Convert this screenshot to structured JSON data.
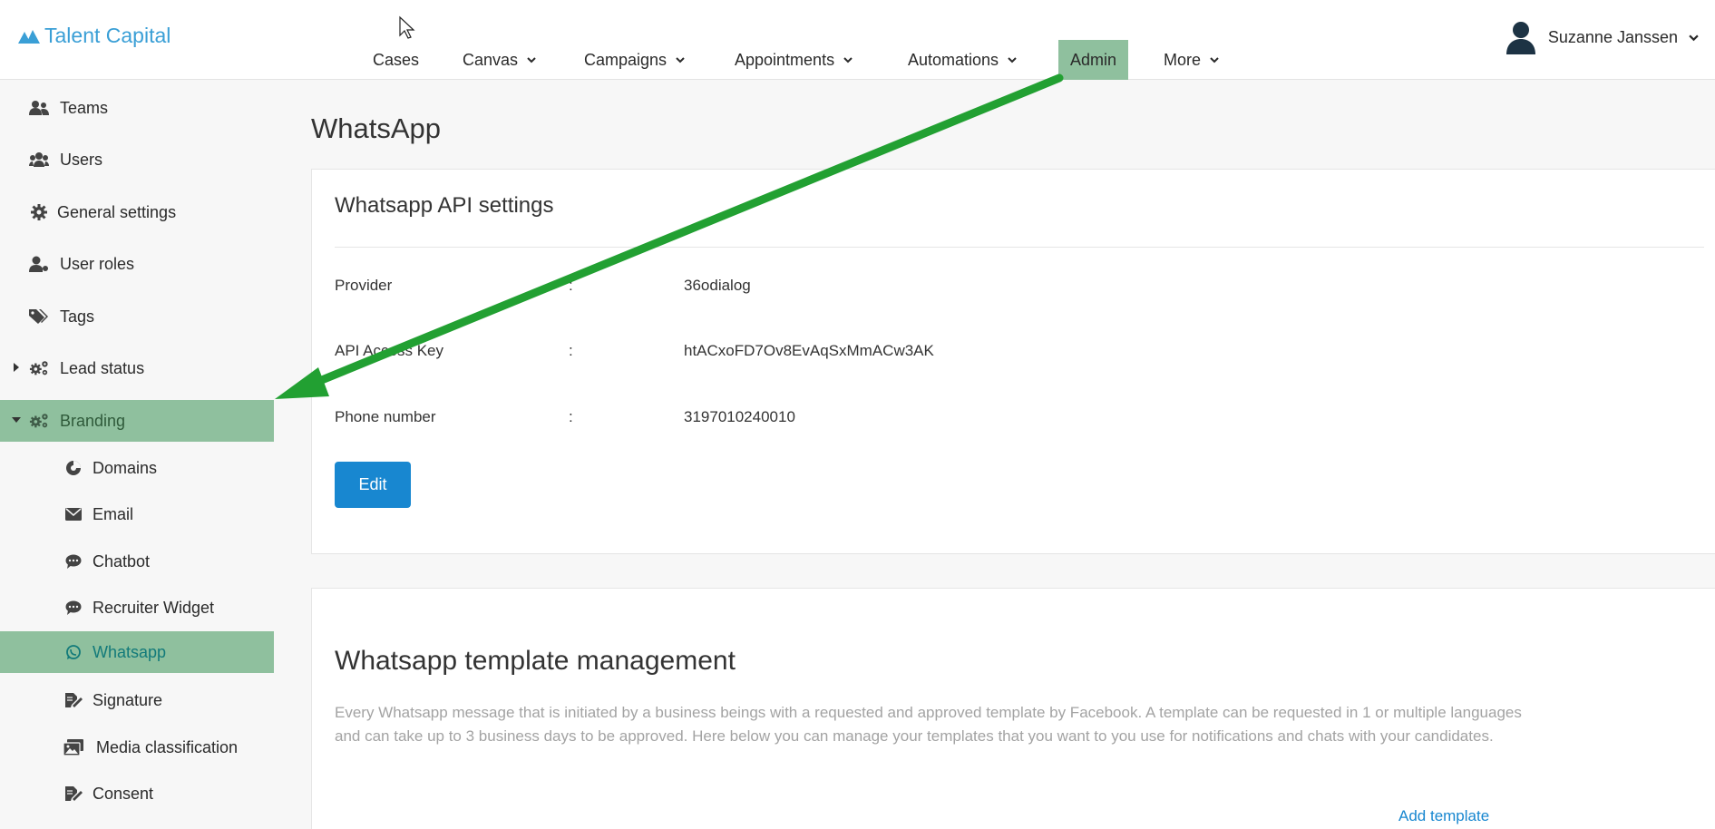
{
  "app": {
    "brand": "Talent Capital",
    "user_name": "Suzanne Janssen"
  },
  "nav": {
    "items": [
      {
        "label": "Cases",
        "has_dropdown": false
      },
      {
        "label": "Canvas",
        "has_dropdown": true
      },
      {
        "label": "Campaigns",
        "has_dropdown": true
      },
      {
        "label": "Appointments",
        "has_dropdown": true
      },
      {
        "label": "Automations",
        "has_dropdown": true
      },
      {
        "label": "Admin",
        "has_dropdown": false,
        "active": true
      },
      {
        "label": "More",
        "has_dropdown": true
      }
    ]
  },
  "sidebar": {
    "items": [
      {
        "label": "Teams",
        "icon": "teams-icon"
      },
      {
        "label": "Users",
        "icon": "users-icon"
      },
      {
        "label": "General settings",
        "icon": "gear-icon"
      },
      {
        "label": "User roles",
        "icon": "user-roles-icon"
      },
      {
        "label": "Tags",
        "icon": "tags-icon"
      },
      {
        "label": "Lead status",
        "icon": "gears-icon",
        "collapsed": true
      },
      {
        "label": "Branding",
        "icon": "gears-icon",
        "expanded": true,
        "highlighted": true
      }
    ],
    "branding_children": [
      {
        "label": "Domains",
        "icon": "domains-icon"
      },
      {
        "label": "Email",
        "icon": "envelope-icon"
      },
      {
        "label": "Chatbot",
        "icon": "chat-bubble-icon"
      },
      {
        "label": "Recruiter Widget",
        "icon": "chat-bubble-icon"
      },
      {
        "label": "Whatsapp",
        "icon": "whatsapp-icon",
        "active": true
      },
      {
        "label": "Signature",
        "icon": "signature-icon"
      },
      {
        "label": "Media classification",
        "icon": "media-icon"
      },
      {
        "label": "Consent",
        "icon": "signature-icon"
      }
    ]
  },
  "main": {
    "page_title": "WhatsApp",
    "api_settings": {
      "title": "Whatsapp API settings",
      "rows": [
        {
          "label": "Provider",
          "separator": ":",
          "value": "36odialog"
        },
        {
          "label": "API Access Key",
          "separator": ":",
          "value": "htACxoFD7Ov8EvAqSxMmACw3AK"
        },
        {
          "label": "Phone number",
          "separator": ":",
          "value": "3197010240010"
        }
      ],
      "edit_label": "Edit"
    },
    "templates": {
      "title": "Whatsapp template management",
      "description": "Every Whatsapp message that is initiated by a business beings with a requested and approved template by Facebook. A template can be requested in 1 or multiple languages and can take up to 3 business days to be approved. Here below you can manage your templates that you want to you use for notifications and chats with your candidates.",
      "add_label": "Add template"
    }
  },
  "colors": {
    "brand": "#3a9fd6",
    "highlight": "#8fc09e",
    "primary_button": "#1887d0",
    "annotation_arrow": "#22a032"
  }
}
